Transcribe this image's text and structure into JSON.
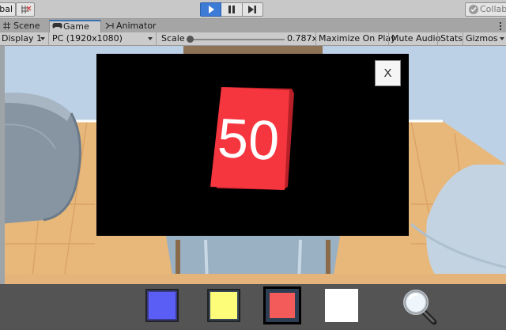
{
  "toolbar": {
    "global_label": "bal",
    "collab_label": "Collab"
  },
  "tabs": {
    "scene": "Scene",
    "game": "Game",
    "animator": "Animator"
  },
  "game_controls": {
    "display": "Display 1",
    "resolution": "PC (1920x1080)",
    "scale_label": "Scale",
    "scale_value": "0.787x",
    "scale_fraction": 0.0,
    "maximize_on_play": "Maximize On Play",
    "mute_audio": "Mute Audio",
    "stats": "Stats",
    "gizmos": "Gizmos"
  },
  "modal": {
    "close_label": "X",
    "number": "50",
    "card_color": "#f5363f"
  },
  "palette": {
    "colors": {
      "blue": "#5a5ef5",
      "yellow": "#fdfd7a",
      "red": "#f35b5b",
      "white": "#ffffff"
    },
    "selected": "red"
  }
}
